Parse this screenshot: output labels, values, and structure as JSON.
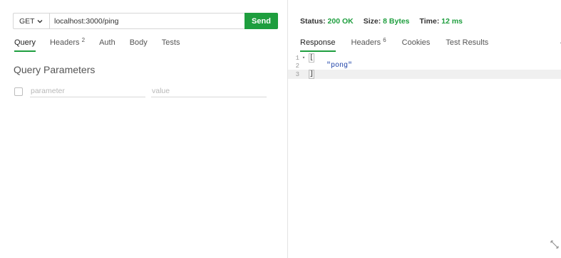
{
  "request": {
    "method": "GET",
    "url": "localhost:3000/ping",
    "send_label": "Send"
  },
  "request_tabs": [
    {
      "label": "Query",
      "active": true
    },
    {
      "label": "Headers",
      "badge": "2"
    },
    {
      "label": "Auth"
    },
    {
      "label": "Body"
    },
    {
      "label": "Tests"
    }
  ],
  "query": {
    "title": "Query Parameters",
    "param_placeholder": "parameter",
    "value_placeholder": "value"
  },
  "status": {
    "status_label": "Status:",
    "status_value": "200 OK",
    "size_label": "Size:",
    "size_value": "8 Bytes",
    "time_label": "Time:",
    "time_value": "12 ms"
  },
  "response_tabs": [
    {
      "label": "Response",
      "active": true
    },
    {
      "label": "Headers",
      "badge": "6"
    },
    {
      "label": "Cookies"
    },
    {
      "label": "Test Results"
    }
  ],
  "response_extra": "{",
  "code": {
    "lines": [
      {
        "num": "1",
        "text": "["
      },
      {
        "num": "2",
        "text": "\"pong\""
      },
      {
        "num": "3",
        "text": "]"
      }
    ]
  },
  "colors": {
    "accent": "#1e9e3e",
    "string": "#1f43a8"
  },
  "icons": {
    "method_dropdown": "chevron-down-icon",
    "fold": "fold-arrow-icon",
    "resize": "resize-icon"
  }
}
